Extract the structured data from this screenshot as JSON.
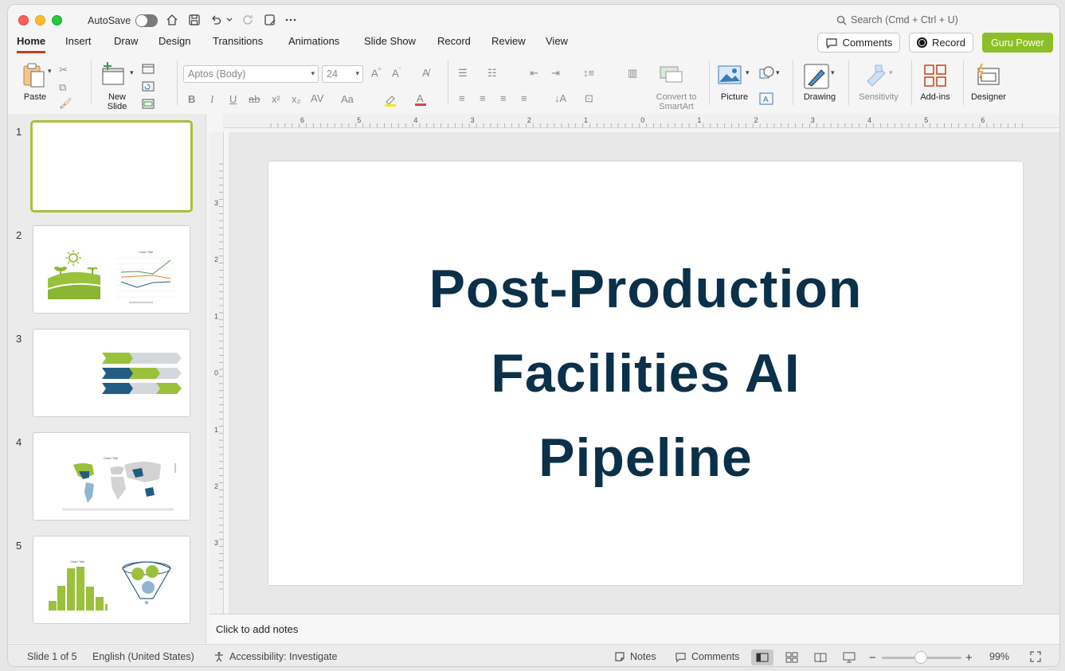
{
  "titlebar": {
    "autosave_label": "AutoSave",
    "search_placeholder": "Search (Cmd + Ctrl + U)"
  },
  "tabs": [
    "Home",
    "Insert",
    "Draw",
    "Design",
    "Transitions",
    "Animations",
    "Slide Show",
    "Record",
    "Review",
    "View"
  ],
  "header_buttons": {
    "comments": "Comments",
    "record": "Record",
    "guru": "Guru Power"
  },
  "ribbon": {
    "paste": "Paste",
    "new_slide_1": "New",
    "new_slide_2": "Slide",
    "font_name": "Aptos (Body)",
    "font_size": "24",
    "convert_1": "Convert to",
    "convert_2": "SmartArt",
    "picture": "Picture",
    "drawing": "Drawing",
    "sensitivity": "Sensitivity",
    "addins": "Add-ins",
    "designer": "Designer"
  },
  "slides": [
    {
      "num": "1"
    },
    {
      "num": "2"
    },
    {
      "num": "3"
    },
    {
      "num": "4"
    },
    {
      "num": "5"
    }
  ],
  "slide": {
    "title_line1": "Post-Production",
    "title_line2": "Facilities AI",
    "title_line3": "Pipeline"
  },
  "notes_placeholder": "Click to add notes",
  "status": {
    "slide_counter": "Slide 1 of 5",
    "language": "English (United States)",
    "accessibility": "Accessibility: Investigate",
    "notes": "Notes",
    "comments": "Comments",
    "zoom": "99%"
  },
  "ruler_h_labels": [
    "6",
    "5",
    "4",
    "3",
    "2",
    "1",
    "0",
    "1",
    "2",
    "3",
    "4",
    "5",
    "6"
  ],
  "ruler_v_labels": [
    "3",
    "2",
    "1",
    "0",
    "1",
    "2",
    "3"
  ],
  "colors": {
    "accent_green": "#8cbf26",
    "title_navy": "#0b3049",
    "active_tab_underline": "#c43e1c"
  }
}
